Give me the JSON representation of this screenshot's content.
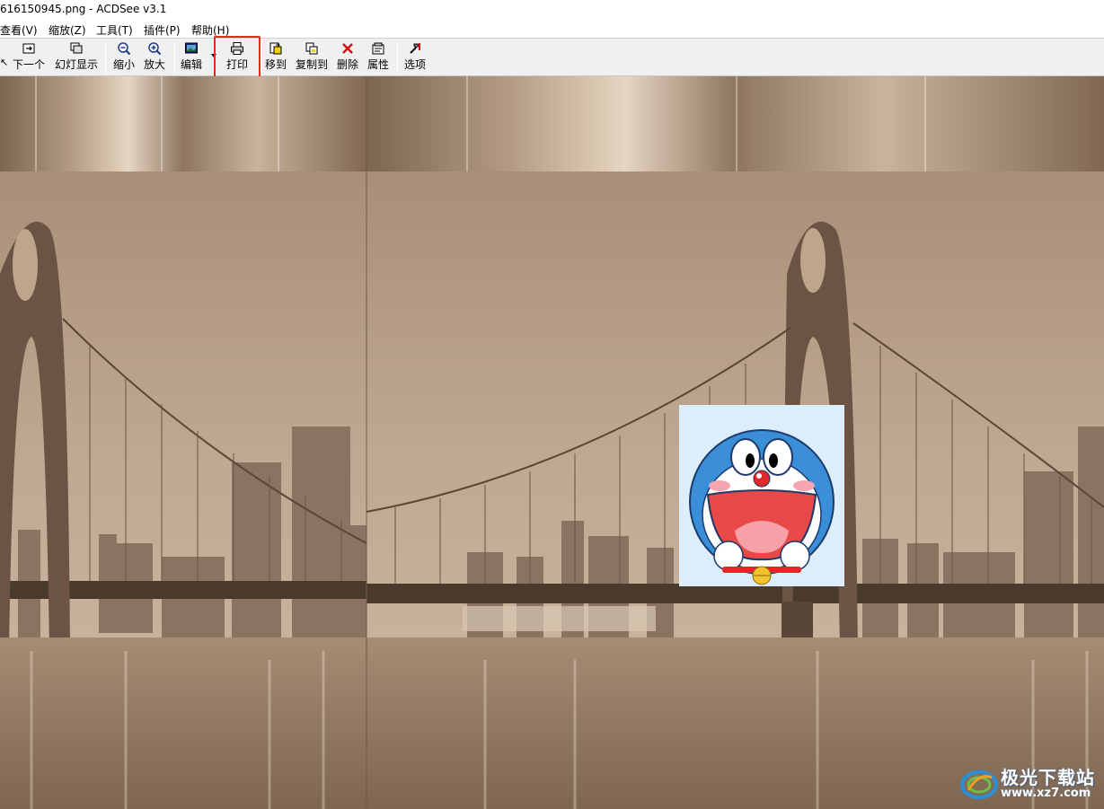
{
  "window": {
    "title": "616150945.png - ACDSee v3.1"
  },
  "menu": [
    {
      "label": "查看(V)"
    },
    {
      "label": "缩放(Z)"
    },
    {
      "label": "工具(T)"
    },
    {
      "label": "插件(P)"
    },
    {
      "label": "帮助(H)"
    }
  ],
  "toolbar": {
    "next": "下一个",
    "slideshow": "幻灯显示",
    "zoom_out": "缩小",
    "zoom_in": "放大",
    "edit": "编辑",
    "print": "打印",
    "move_to": "移到",
    "copy_to": "复制到",
    "delete": "删除",
    "properties": "属性",
    "options": "选项"
  },
  "watermark": {
    "name": "极光下载站",
    "url": "www.xz7.com"
  },
  "colors": {
    "highlight": "#e8281d",
    "sepia": "#a38b74",
    "toolbar_bg": "#f0f0f0"
  }
}
